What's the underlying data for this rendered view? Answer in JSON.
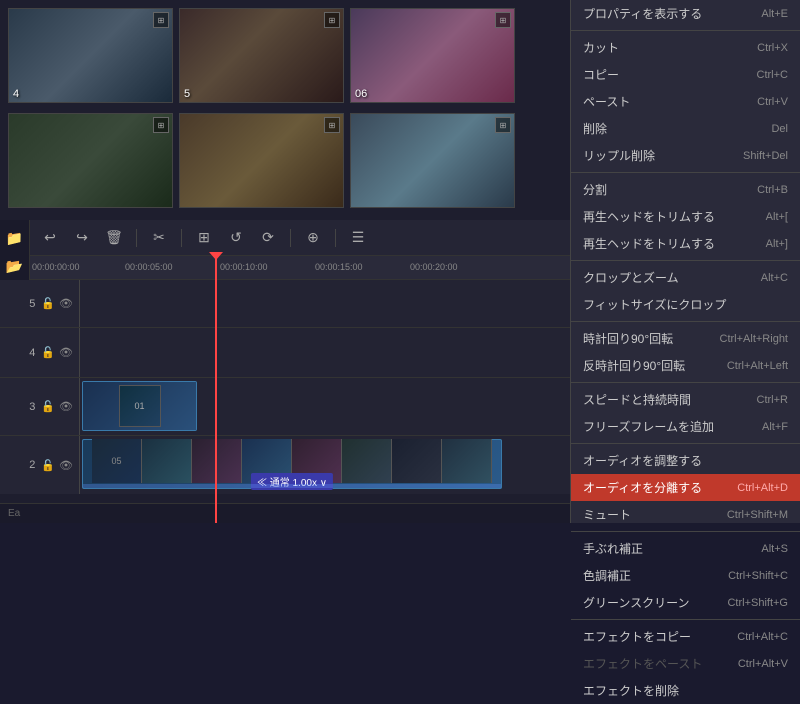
{
  "media": {
    "thumbnails": [
      {
        "id": "4",
        "label": "4",
        "class": "thumb-4"
      },
      {
        "id": "5",
        "label": "5",
        "class": "thumb-5"
      },
      {
        "id": "6",
        "label": "06",
        "class": "thumb-6"
      },
      {
        "id": "7",
        "label": "",
        "class": "thumb-7"
      },
      {
        "id": "8",
        "label": "",
        "class": "thumb-8"
      },
      {
        "id": "9",
        "label": "",
        "class": "thumb-9"
      }
    ]
  },
  "toolbar": {
    "tools": [
      "↩",
      "↪",
      "🗑",
      "✂",
      "⊞",
      "↩",
      "⟳",
      "⊕",
      "☰"
    ]
  },
  "ruler": {
    "times": [
      "00:00:00:00",
      "00:00:05:00",
      "00:00:10:00",
      "00:00:15:00",
      "00:00:20:00"
    ]
  },
  "tracks": [
    {
      "number": "5",
      "locked": false,
      "visible": true
    },
    {
      "number": "4",
      "locked": false,
      "visible": true
    },
    {
      "number": "3",
      "locked": false,
      "visible": true
    },
    {
      "number": "2",
      "locked": false,
      "visible": true
    }
  ],
  "context_menu": {
    "items": [
      {
        "label": "プロパティを表示する",
        "shortcut": "Alt+E",
        "disabled": false,
        "highlighted": false,
        "separator_after": false
      },
      {
        "label": "",
        "separator": true
      },
      {
        "label": "カット",
        "shortcut": "Ctrl+X",
        "disabled": false,
        "highlighted": false,
        "separator_after": false
      },
      {
        "label": "コピー",
        "shortcut": "Ctrl+C",
        "disabled": false,
        "highlighted": false,
        "separator_after": false
      },
      {
        "label": "ペースト",
        "shortcut": "Ctrl+V",
        "disabled": false,
        "highlighted": false,
        "separator_after": false
      },
      {
        "label": "削除",
        "shortcut": "Del",
        "disabled": false,
        "highlighted": false,
        "separator_after": false
      },
      {
        "label": "リップル削除",
        "shortcut": "Shift+Del",
        "disabled": false,
        "highlighted": false,
        "separator_after": true
      },
      {
        "label": "分割",
        "shortcut": "Ctrl+B",
        "disabled": false,
        "highlighted": false,
        "separator_after": false
      },
      {
        "label": "再生ヘッドをトリムする",
        "shortcut": "Alt+[",
        "disabled": false,
        "highlighted": false,
        "separator_after": false
      },
      {
        "label": "再生ヘッドをトリムする",
        "shortcut": "Alt+]",
        "disabled": false,
        "highlighted": false,
        "separator_after": true
      },
      {
        "label": "クロップとズーム",
        "shortcut": "Alt+C",
        "disabled": false,
        "highlighted": false,
        "separator_after": false
      },
      {
        "label": "フィットサイズにクロップ",
        "shortcut": "",
        "disabled": false,
        "highlighted": false,
        "separator_after": true
      },
      {
        "label": "時計回り90°回転",
        "shortcut": "Ctrl+Alt+Right",
        "disabled": false,
        "highlighted": false,
        "separator_after": false
      },
      {
        "label": "反時計回り90°回転",
        "shortcut": "Ctrl+Alt+Left",
        "disabled": false,
        "highlighted": false,
        "separator_after": true
      },
      {
        "label": "スピードと持続時間",
        "shortcut": "Ctrl+R",
        "disabled": false,
        "highlighted": false,
        "separator_after": false
      },
      {
        "label": "フリーズフレームを追加",
        "shortcut": "Alt+F",
        "disabled": false,
        "highlighted": false,
        "separator_after": true
      },
      {
        "label": "オーディオを調整する",
        "shortcut": "",
        "disabled": false,
        "highlighted": false,
        "separator_after": false
      },
      {
        "label": "オーディオを分離する",
        "shortcut": "Ctrl+Alt+D",
        "disabled": false,
        "highlighted": true,
        "separator_after": false
      },
      {
        "label": "ミュート",
        "shortcut": "Ctrl+Shift+M",
        "disabled": false,
        "highlighted": false,
        "separator_after": true
      },
      {
        "label": "手ぶれ補正",
        "shortcut": "Alt+S",
        "disabled": false,
        "highlighted": false,
        "separator_after": false
      },
      {
        "label": "色調補正",
        "shortcut": "Ctrl+Shift+C",
        "disabled": false,
        "highlighted": false,
        "separator_after": false
      },
      {
        "label": "グリーンスクリーン",
        "shortcut": "Ctrl+Shift+G",
        "disabled": false,
        "highlighted": false,
        "separator_after": true
      },
      {
        "label": "エフェクトをコピー",
        "shortcut": "Ctrl+Alt+C",
        "disabled": false,
        "highlighted": false,
        "separator_after": false
      },
      {
        "label": "エフェクトをペースト",
        "shortcut": "Ctrl+Alt+V",
        "disabled": true,
        "highlighted": false,
        "separator_after": false
      },
      {
        "label": "エフェクトを削除",
        "shortcut": "",
        "disabled": false,
        "highlighted": false,
        "separator_after": false
      }
    ]
  },
  "speed_label": "≪ 通常 1.00x ∨",
  "status": {
    "label": "Ea"
  }
}
